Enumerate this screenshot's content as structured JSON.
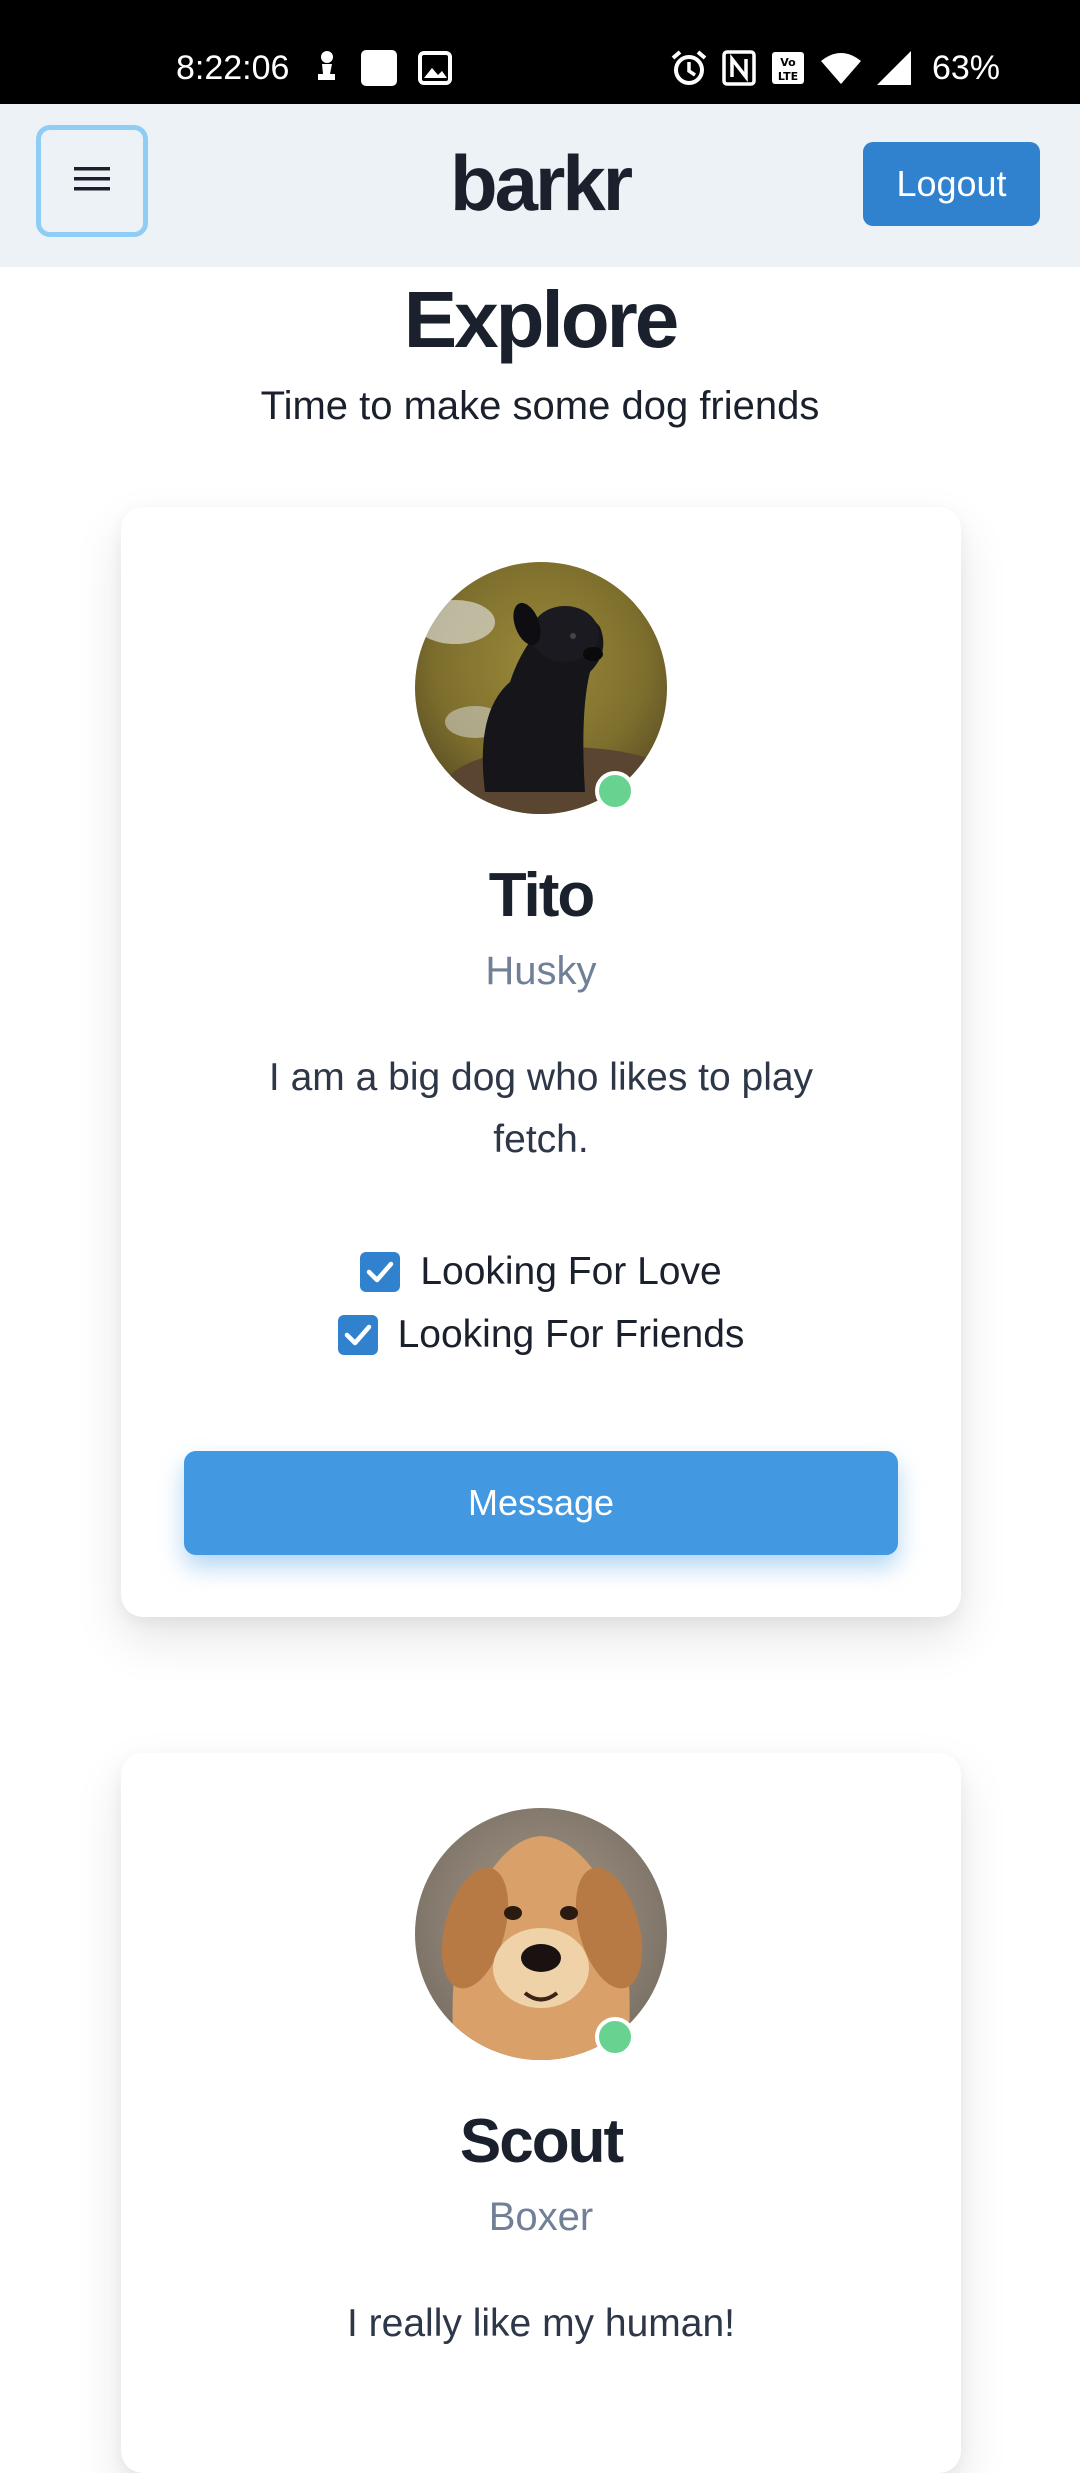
{
  "status_bar": {
    "time": "8:22:06",
    "battery_percent": "63%",
    "icons_left": [
      "chess-pawn-icon",
      "app-icon",
      "image-icon"
    ],
    "icons_right": [
      "alarm-icon",
      "nfc-icon",
      "volte-icon",
      "wifi-icon",
      "signal-icon"
    ]
  },
  "header": {
    "brand": "barkr",
    "menu_icon": "hamburger-icon",
    "logout_label": "Logout"
  },
  "page": {
    "title": "Explore",
    "subtitle": "Time to make some dog friends"
  },
  "dogs": [
    {
      "name": "Tito",
      "breed": "Husky",
      "bio": "I am a big dog who likes to play fetch.",
      "checks": [
        {
          "label": "Looking For Love",
          "checked": true
        },
        {
          "label": "Looking For Friends",
          "checked": true
        }
      ],
      "online": true,
      "message_label": "Message"
    },
    {
      "name": "Scout",
      "breed": "Boxer",
      "bio": "I really like my human!",
      "online": true
    }
  ],
  "colors": {
    "header_bg": "#edf2f7",
    "primary": "#3182ce",
    "message_button": "#4299e1",
    "online": "#68d391",
    "muted_text": "#718096"
  }
}
